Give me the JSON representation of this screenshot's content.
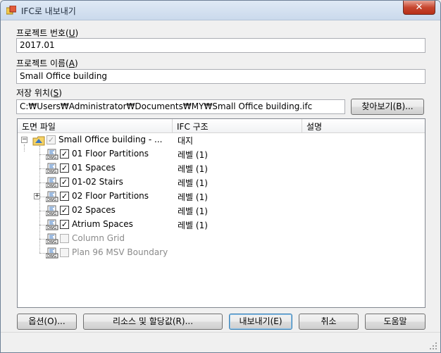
{
  "window": {
    "title": "IFC로 내보내기",
    "close_glyph": "✕"
  },
  "project_number": {
    "label": "프로젝트 번호(",
    "hotkey": "U",
    "label_end": ")",
    "value": "2017.01"
  },
  "project_name": {
    "label": "프로젝트 이름(",
    "hotkey": "A",
    "label_end": ")",
    "value": "Small Office building"
  },
  "save_location": {
    "label": "저장 위치(",
    "hotkey": "S",
    "label_end": ")",
    "value": "C:₩Users₩Administrator₩Documents₩MY₩Small Office building.ifc",
    "browse_label": "찾아보기(B)..."
  },
  "tree": {
    "columns": [
      "도면 파일",
      "IFC 구조",
      "설명"
    ],
    "root": {
      "name": "Small Office building - ...",
      "structure": "대지"
    },
    "items": [
      {
        "name": "01 Floor Partitions",
        "structure": "레벨 (1)",
        "checked": true,
        "enabled": true,
        "expander": false
      },
      {
        "name": "01 Spaces",
        "structure": "레벨 (1)",
        "checked": true,
        "enabled": true,
        "expander": false
      },
      {
        "name": "01-02 Stairs",
        "structure": "레벨 (1)",
        "checked": true,
        "enabled": true,
        "expander": false
      },
      {
        "name": "02 Floor Partitions",
        "structure": "레벨 (1)",
        "checked": true,
        "enabled": true,
        "expander": true
      },
      {
        "name": "02 Spaces",
        "structure": "레벨 (1)",
        "checked": true,
        "enabled": true,
        "expander": false
      },
      {
        "name": "Atrium Spaces",
        "structure": "레벨 (1)",
        "checked": true,
        "enabled": true,
        "expander": false
      },
      {
        "name": "Column Grid",
        "structure": "",
        "checked": false,
        "enabled": false,
        "expander": false
      },
      {
        "name": "Plan 96 MSV Boundary",
        "structure": "",
        "checked": false,
        "enabled": false,
        "expander": false
      }
    ]
  },
  "buttons": {
    "options": "옵션(O)...",
    "resources": "리소스 및 할당값(R)...",
    "export": "내보내기(E)",
    "cancel": "취소",
    "help": "도움말"
  },
  "colors": {
    "titlebar": "#cad9ec",
    "close": "#c7462f"
  }
}
